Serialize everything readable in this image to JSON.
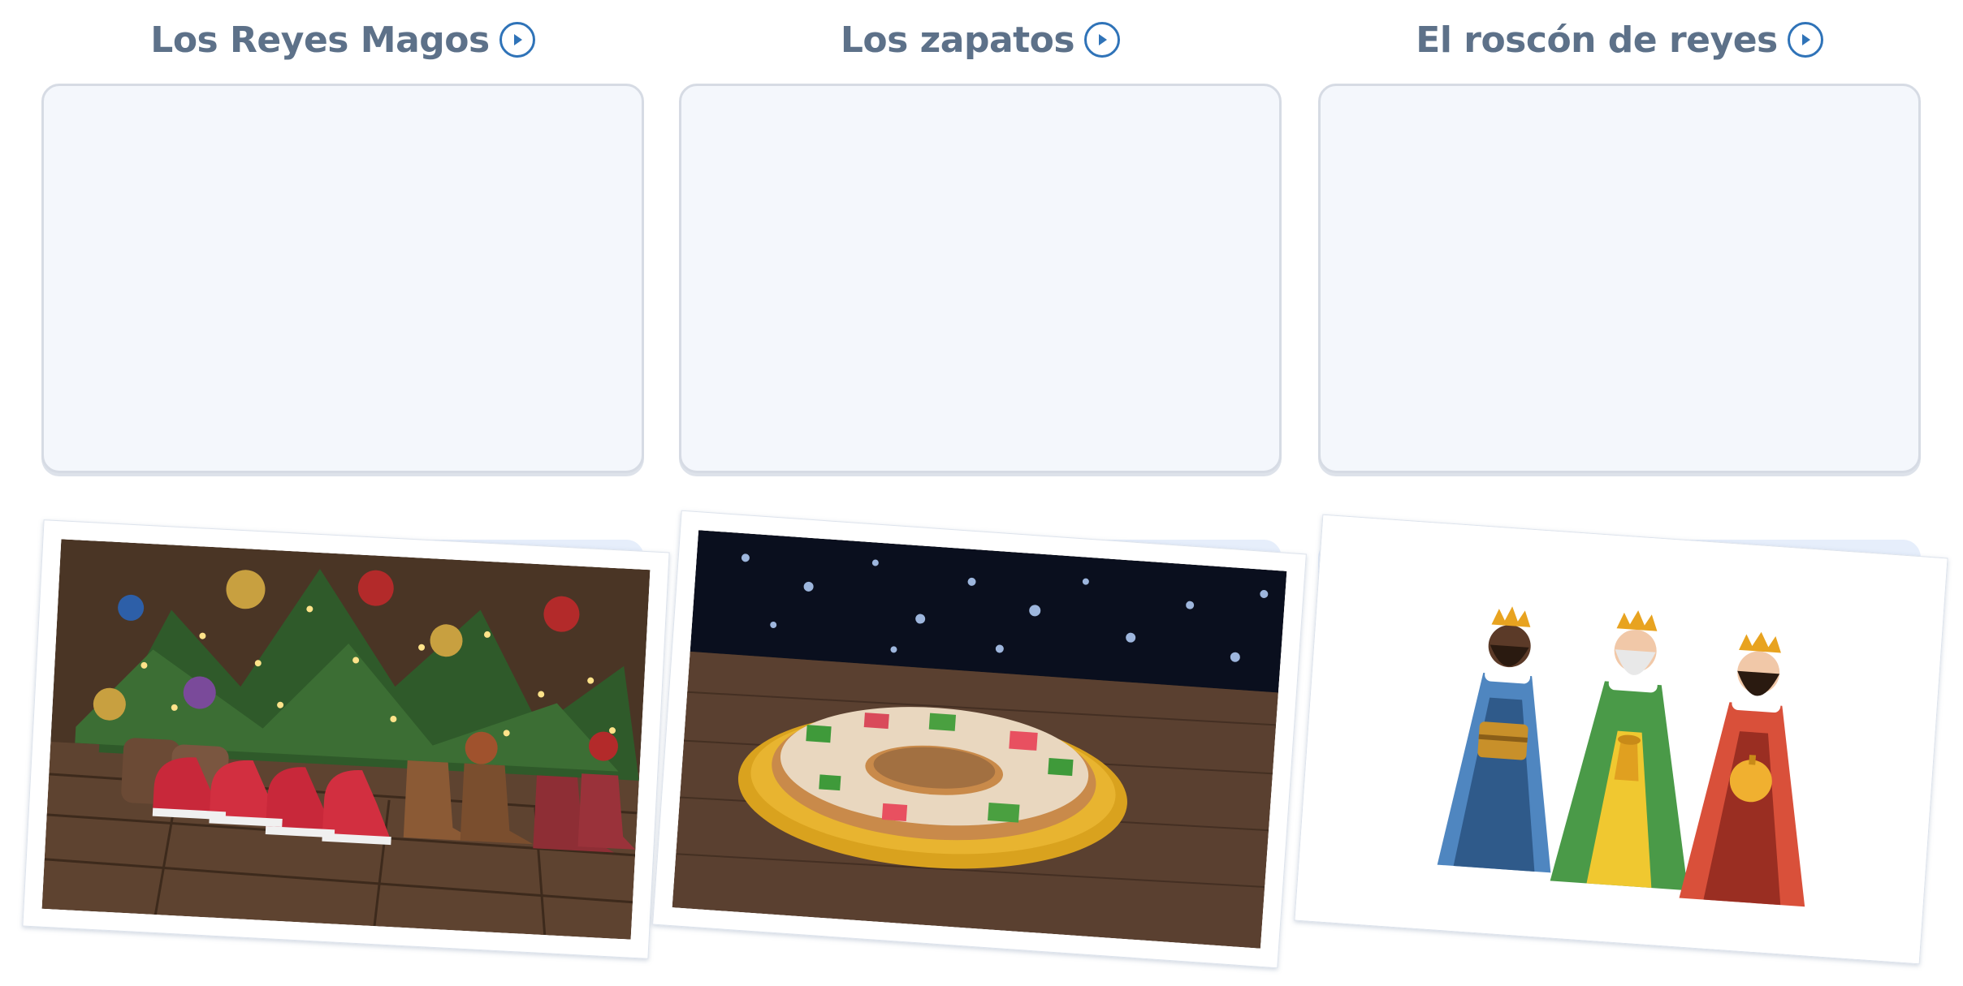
{
  "columns": [
    {
      "title": "Los Reyes Magos",
      "play_icon": "play-circle-icon"
    },
    {
      "title": "Los zapatos",
      "play_icon": "play-circle-icon"
    },
    {
      "title": "El roscón de reyes",
      "play_icon": "play-circle-icon"
    }
  ],
  "cards": [
    {
      "image": "shoes-under-christmas-tree-photo"
    },
    {
      "image": "roscon-de-reyes-cake-photo"
    },
    {
      "image": "three-wise-men-illustration"
    }
  ],
  "colors": {
    "title": "#5d7189",
    "accent": "#2f73b8",
    "drop_zone_bg": "#f4f7fc",
    "tray_bg": "#e6eefb"
  }
}
